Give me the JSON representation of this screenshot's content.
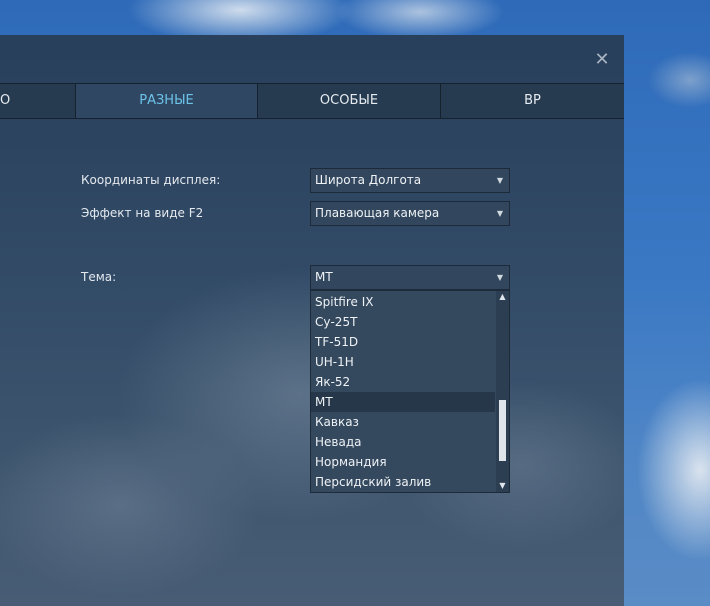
{
  "window": {
    "close_glyph": "✕"
  },
  "tabs": [
    {
      "label": "О",
      "active": false
    },
    {
      "label": "РАЗНЫЕ",
      "active": true
    },
    {
      "label": "ОСОБЫЕ",
      "active": false
    },
    {
      "label": "ВР",
      "active": false
    }
  ],
  "settings": {
    "display_coords": {
      "label": "Координаты дисплея:",
      "value": "Широта Долгота"
    },
    "f2_effect": {
      "label": "Эффект на виде F2",
      "value": "Плавающая камера"
    },
    "theme": {
      "label": "Тема:",
      "value": "МТ"
    }
  },
  "theme_dropdown": {
    "options": [
      "Spitfire IX",
      "Су-25Т",
      "TF-51D",
      "UH-1H",
      "Як-52",
      "МТ",
      "Кавказ",
      "Невада",
      "Нормандия",
      "Персидский залив"
    ],
    "selected": "МТ",
    "scroll_position": 0.85,
    "visible_fraction": 0.35
  },
  "icons": {
    "arrow_down": "▼",
    "arrow_up": "▲"
  },
  "colors": {
    "active_tab": "#6cc3e8",
    "panel": "#2a3e55"
  }
}
